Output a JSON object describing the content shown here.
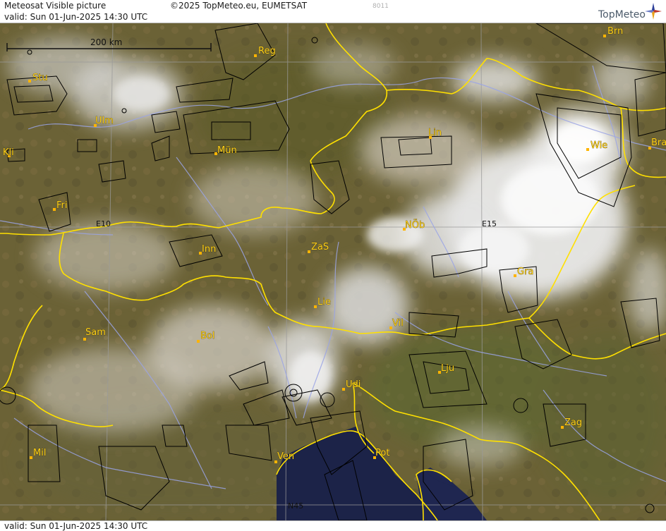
{
  "header": {
    "title": "Meteosat Visible picture",
    "valid": "valid:  Sun  01-Jun-2025  14:30 UTC",
    "copyright": "©2025 TopMeteo.eu, EUMETSAT",
    "image_number": "8011",
    "logo_text": "TopMeteo"
  },
  "footer": {
    "valid": "valid:  Sun  01-Jun-2025  14:30 UTC"
  },
  "map": {
    "scale_bar_label": "200 km",
    "grid_labels": [
      "E10",
      "E15",
      "N45"
    ],
    "cities": [
      "Reg",
      "Brn",
      "Stu",
      "Ulm",
      "Mün",
      "Lin",
      "Wie",
      "Bra",
      "Kli",
      "Fri",
      "Inn",
      "ZaS",
      "NÖb",
      "Gra",
      "Lie",
      "Vil",
      "Sam",
      "Bol",
      "Lju",
      "Udi",
      "Zag",
      "Mil",
      "Ven",
      "Pot"
    ],
    "colors": {
      "border": "#ffe000",
      "rivers": "#9aa4e6",
      "airspace": "#000000",
      "city_label": "#ffd21a",
      "sea": "#1c2348",
      "land": "#6b6236"
    }
  }
}
